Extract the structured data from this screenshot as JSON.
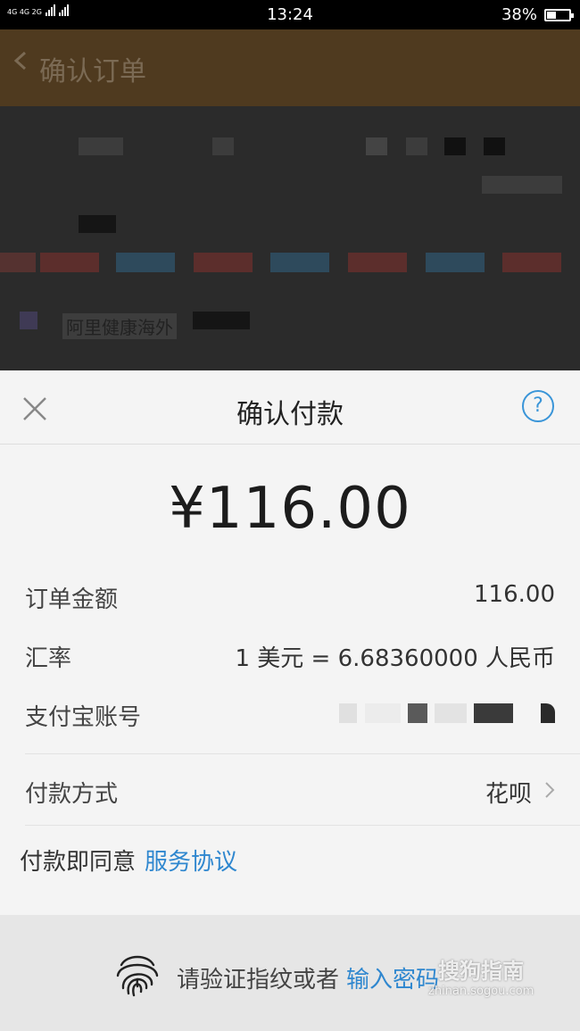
{
  "status_bar": {
    "network": "4G 4G 2G",
    "time": "13:24",
    "battery": "38%",
    "battery_level": 0.38
  },
  "background_page": {
    "title": "确认订单",
    "store_name": "阿里健康海外"
  },
  "payment_sheet": {
    "title": "确认付款",
    "close_icon": "close-icon",
    "help_icon": "question-icon",
    "help_glyph": "?",
    "amount": "¥116.00",
    "rows": [
      {
        "label": "订单金额",
        "value": "116.00"
      },
      {
        "label": "汇率",
        "value": "1 美元 = 6.68360000 人民币"
      },
      {
        "label": "支付宝账号",
        "value": ""
      },
      {
        "label": "付款方式",
        "value": "花呗"
      }
    ],
    "agreement_prefix": "付款即同意",
    "agreement_link": "服务协议",
    "accent_color": "#2f87cf"
  },
  "footer": {
    "prompt": "请验证指纹或者",
    "link": "输入密码"
  },
  "watermark": {
    "name": "搜狗指南",
    "url": "zhinan.sogou.com"
  }
}
